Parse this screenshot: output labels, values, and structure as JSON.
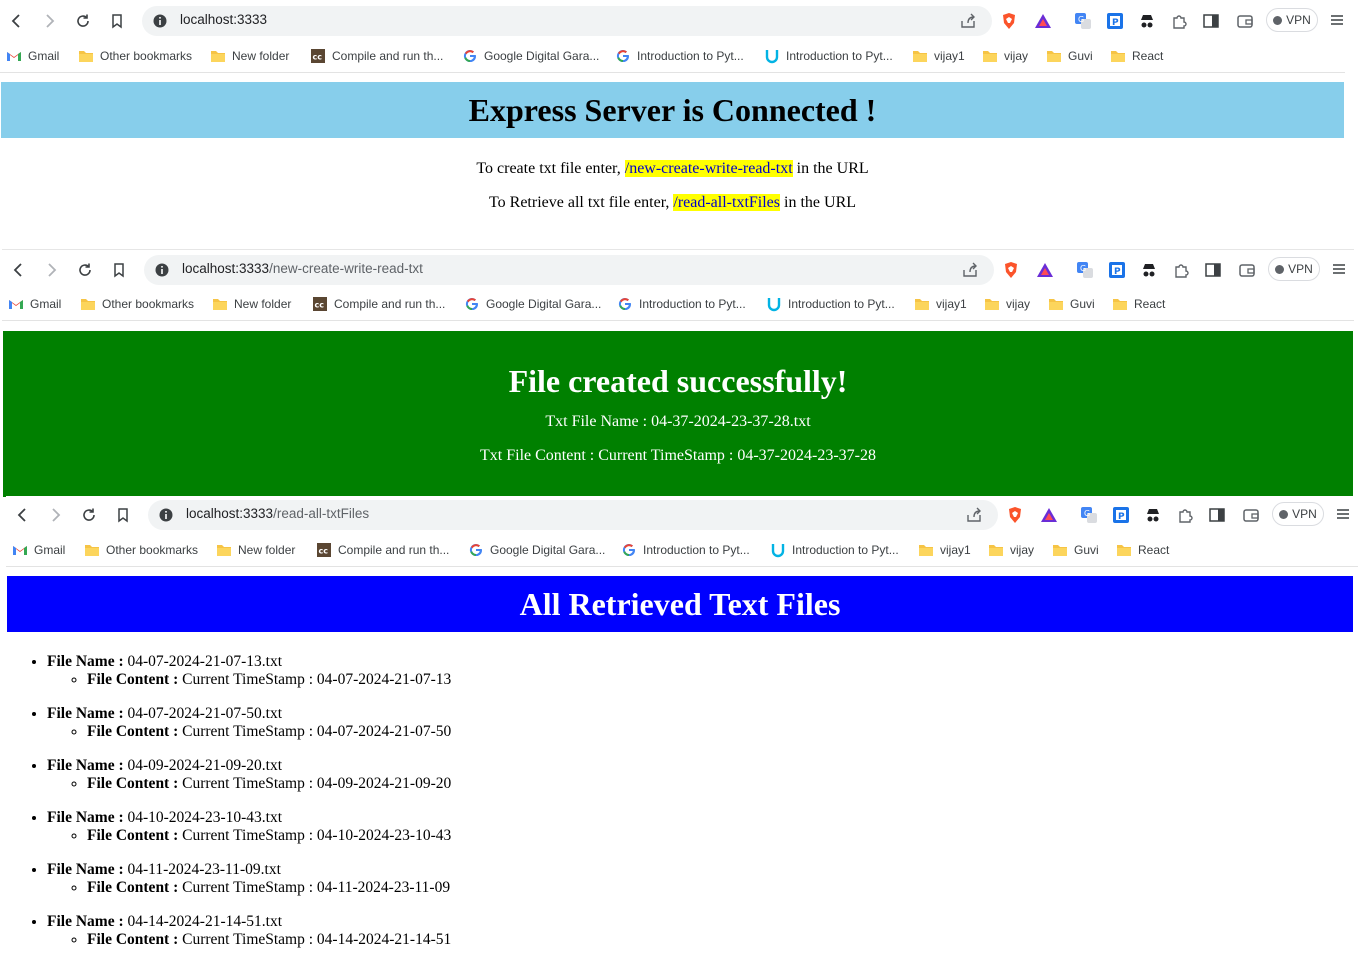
{
  "bookmarks": [
    {
      "label": "Gmail",
      "icon": "gmail-icon"
    },
    {
      "label": "Other bookmarks",
      "icon": "folder-icon"
    },
    {
      "label": "New folder",
      "icon": "folder-icon"
    },
    {
      "label": "Compile and run th...",
      "icon": "cc-icon"
    },
    {
      "label": "Google Digital Gara...",
      "icon": "google-icon"
    },
    {
      "label": "Introduction to Pyt...",
      "icon": "google-icon"
    },
    {
      "label": "Introduction to Pyt...",
      "icon": "udacity-icon"
    },
    {
      "label": "vijay1",
      "icon": "folder-icon"
    },
    {
      "label": "vijay",
      "icon": "folder-icon"
    },
    {
      "label": "Guvi",
      "icon": "folder-icon"
    },
    {
      "label": "React",
      "icon": "folder-icon"
    }
  ],
  "vpn_label": "VPN",
  "shot1": {
    "url_host": "localhost:3333",
    "url_path": "",
    "heading": "Express Server is Connected !",
    "line1_prefix": "To create txt file enter, ",
    "line1_link": "/new-create-write-read-txt",
    "line1_suffix": " in the URL",
    "line2_prefix": "To Retrieve all txt file enter, ",
    "line2_link": "/read-all-txtFiles",
    "line2_suffix": " in the URL",
    "banner_color": "#87ceeb"
  },
  "shot2": {
    "url_host": "localhost:3333",
    "url_path": "/new-create-write-read-txt",
    "heading": "File created successfully!",
    "name_line": "Txt File Name : 04-37-2024-23-37-28.txt",
    "content_line": "Txt File Content : Current TimeStamp : 04-37-2024-23-37-28",
    "banner_color": "#008000"
  },
  "shot3": {
    "url_host": "localhost:3333",
    "url_path": "/read-all-txtFiles",
    "heading": "All Retrieved Text Files",
    "banner_color": "#0000ff",
    "name_label": "File Name :",
    "content_label": "File Content :",
    "files": [
      {
        "name": "04-07-2024-21-07-13.txt",
        "content": "Current TimeStamp : 04-07-2024-21-07-13"
      },
      {
        "name": "04-07-2024-21-07-50.txt",
        "content": "Current TimeStamp : 04-07-2024-21-07-50"
      },
      {
        "name": "04-09-2024-21-09-20.txt",
        "content": "Current TimeStamp : 04-09-2024-21-09-20"
      },
      {
        "name": "04-10-2024-23-10-43.txt",
        "content": "Current TimeStamp : 04-10-2024-23-10-43"
      },
      {
        "name": "04-11-2024-23-11-09.txt",
        "content": "Current TimeStamp : 04-11-2024-23-11-09"
      },
      {
        "name": "04-14-2024-21-14-51.txt",
        "content": "Current TimeStamp : 04-14-2024-21-14-51"
      }
    ]
  }
}
